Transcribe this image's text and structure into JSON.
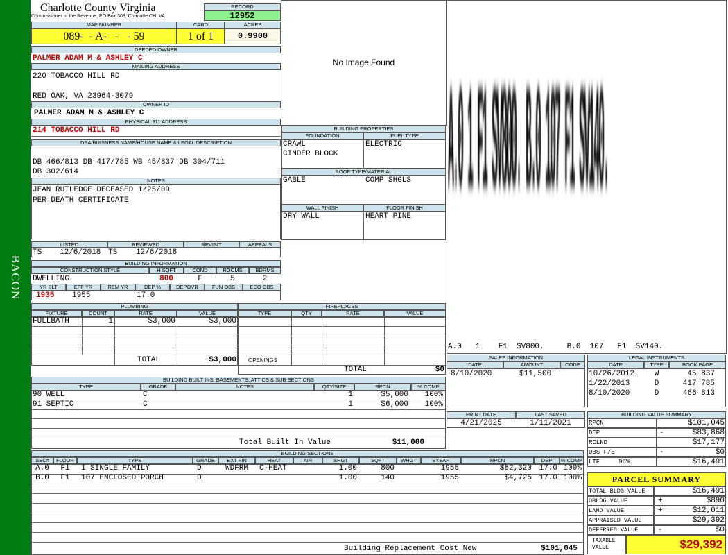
{
  "side": {
    "name": "BACON"
  },
  "county": {
    "title": "Charlotte County Virginia",
    "subtitle": "Commissioner of the Revenue, PO Box 308, Charlotte CH, VA"
  },
  "record": {
    "label": "RECORD",
    "value": "12952"
  },
  "map": {
    "label": "MAP NUMBER",
    "value": "089-  - A-   -   - 59",
    "card_label": "CARD",
    "card": "1 of 1",
    "acres_label": "ACRES",
    "acres": "0.9900"
  },
  "owner": {
    "deeded_label": "DEEDED OWNER",
    "deeded": "PALMER ADAM M & ASHLEY C",
    "mailing_label": "MAILING ADDRESS",
    "mail1": "220 TOBACCO HILL RD",
    "mail2": "RED OAK, VA 23964-3079",
    "ownerid_label": "OWNER ID",
    "ownerid": "PALMER ADAM M & ASHLEY C",
    "phys_label": "PHYSICAL 911 ADDRESS",
    "phys": "214 TOBACCO HILL RD"
  },
  "legal": {
    "label": "DBA/BUISNESS NAME/HOUSE NAME & LEGAL DESCRIPTION",
    "line1": "DB 466/813 DB 417/785 WB 45/837 DB 304/711",
    "line2": "DB 302/614"
  },
  "notes": {
    "label": "NOTES",
    "line1": "JEAN RUTLEDGE DECEASED 1/25/09",
    "line2": "PER DEATH CERTIFICATE"
  },
  "listed": {
    "listed_label": "LISTED",
    "reviewed_label": "REVIEWED",
    "revisit_label": "REVISIT",
    "appeals_label": "APPEALS",
    "lby": "TS",
    "ldate": "12/6/2018",
    "rby": "TS",
    "rdate": "12/6/2018"
  },
  "bldginfo": {
    "label": "BUILDING INFORMATION",
    "cs_label": "CONSTRUCTION STYLE",
    "hsqft_label": "H SQFT",
    "cond_label": "COND",
    "rooms_label": "ROOMS",
    "bdrms_label": "BDRMS",
    "style": "DWELLING",
    "hsqft": "800",
    "cond": "F",
    "rooms": "5",
    "bdrms": "2",
    "yrblt_label": "YR BLT",
    "effyr_label": "EFF YR",
    "remyr_label": "REM YR",
    "dep_label": "DEP %",
    "depovr_label": "DEPOVR",
    "funobs_label": "FUN OBS",
    "ecoobs_label": "ECO OBS",
    "yrblt": "1935",
    "effyr": "1955",
    "dep": "17.0"
  },
  "image": {
    "text": "No Image Found"
  },
  "bprops": {
    "label": "BUILDING PROPERTIES",
    "found_label": "FOUNDATION",
    "fuel_label": "FUEL TYPE",
    "found1": "CRAWL",
    "found2": "CINDER BLOCK",
    "fuel": "ELECTRIC",
    "roof_label": "ROOF TYPE/MATERIAL",
    "roof1": "GABLE",
    "roof2": "COMP SHGLS",
    "wall_label": "WALL FINISH",
    "floor_label": "FLOOR FINISH",
    "wall": "DRY WALL",
    "floor": "HEART PINE"
  },
  "sketch": {
    "bars": "A.0 1 F1 SV800. B.0 107 F1 SV140.",
    "legend": "A.0   1    F1  SV800.     B.0  107   F1  SV140."
  },
  "plumbing": {
    "label": "PLUMBING",
    "h": [
      "FIXTURE",
      "COUNT",
      "RATE",
      "VALUE"
    ],
    "row": [
      "FULLBATH",
      "1",
      "$3,000",
      "$3,000"
    ],
    "total_label": "TOTAL",
    "total": "$3,000"
  },
  "fireplaces": {
    "label": "FIREPLACES",
    "h": [
      "TYPE",
      "QTY",
      "RATE",
      "VALUE"
    ],
    "openings_label": "OPENINGS",
    "total_label": "TOTAL",
    "total": "$0"
  },
  "sales": {
    "label": "SALES INFORMATION",
    "h": [
      "DATE",
      "AMOUNT",
      "CODE"
    ],
    "date": "8/10/2020",
    "amount": "$11,500"
  },
  "legalinst": {
    "label": "LEGAL INSTRUMENTS",
    "h": [
      "DATE",
      "TYPE",
      "BOOK PAGE"
    ],
    "rows": [
      [
        "10/26/2012",
        "W",
        "45 837"
      ],
      [
        "1/22/2013",
        "D",
        "417 785"
      ],
      [
        "8/10/2020",
        "D",
        "466 813"
      ]
    ]
  },
  "builtins": {
    "label": "BUILDING BUILT INS, BASEMENTS, ATTICS & SUB SECTIONS",
    "h": [
      "TYPE",
      "GRADE",
      "NOTES",
      "QTY/SIZE",
      "RPCN",
      "% COMP"
    ],
    "rows": [
      [
        "90 WELL",
        "C",
        "",
        "1",
        "$5,000",
        "100%"
      ],
      [
        "91 SEPTIC",
        "C",
        "",
        "1",
        "$6,000",
        "100%"
      ]
    ],
    "total_label": "Total Built In Value",
    "total": "$11,000"
  },
  "print": {
    "pd_label": "PRINT DATE",
    "ls_label": "LAST SAVED",
    "pd": "4/21/2025",
    "ls": "1/11/2021"
  },
  "bvs": {
    "label": "BUILDING VALUE SUMMARY",
    "rows": [
      [
        "RPCN",
        "",
        "$101,045"
      ],
      [
        "DEP",
        "-",
        "$83,868"
      ],
      [
        "RCLND",
        "",
        "$17,177"
      ],
      [
        "OBS F/E",
        "-",
        "$0"
      ],
      [
        "LTF     96%",
        "",
        "$16,491"
      ]
    ]
  },
  "parcel": {
    "label": "PARCEL SUMMARY",
    "rows": [
      [
        "TOTAL BLDG VALUE",
        "",
        "$16,491"
      ],
      [
        "OBLDG VALUE",
        "+",
        "$890"
      ],
      [
        "LAND VALUE",
        "+",
        "$12,011"
      ],
      [
        "APPRAISED VALUE",
        "",
        "$29,392"
      ],
      [
        "DEFERRED VALUE",
        "-",
        "$0"
      ]
    ],
    "taxable_label1": "TAXABLE",
    "taxable_label2": "VALUE",
    "taxable": "$29,392"
  },
  "sections": {
    "label": "BUILDING SECTIONS",
    "h": [
      "SEC#",
      "FLOOR",
      "TYPE",
      "GRADE",
      "EXT FIN",
      "HEAT",
      "AIR",
      "SHGT",
      "SQFT",
      "WHGT",
      "EYEAR",
      "RPCN",
      "DEP",
      "% COMP"
    ],
    "rows": [
      [
        "A.0",
        "F1",
        "1 SINGLE FAMILY",
        "D",
        "WDFRM",
        "C-HEAT",
        "",
        "1.00",
        "800",
        "",
        "1955",
        "$82,320",
        "17.0",
        "100%"
      ],
      [
        "B.0",
        "F1",
        "107 ENCLOSED PORCH",
        "D",
        "",
        "",
        "",
        "1.00",
        "140",
        "",
        "1955",
        "$4,725",
        "17.0",
        "100%"
      ]
    ],
    "brcn_label": "Building Replacement Cost New",
    "brcn": "$101,045"
  }
}
